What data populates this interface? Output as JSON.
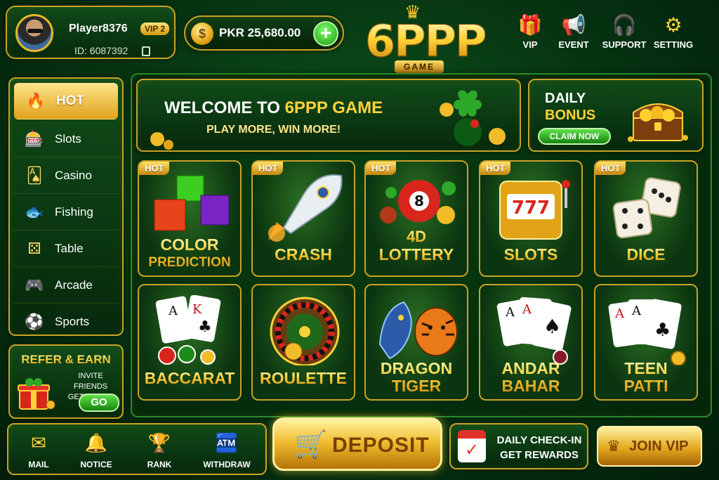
{
  "player": {
    "name": "Player8376",
    "vip": "VIP 2",
    "id": "ID: 6087392"
  },
  "balance": {
    "text": "PKR 25,680.00",
    "add": "+"
  },
  "logo": {
    "main": "6PPP",
    "sub": "GAME"
  },
  "top_actions": [
    {
      "label": "VIP",
      "icon": "gift-icon"
    },
    {
      "label": "EVENT",
      "icon": "megaphone-icon"
    },
    {
      "label": "SUPPORT",
      "icon": "headset-icon"
    },
    {
      "label": "SETTING",
      "icon": "gear-icon"
    }
  ],
  "sidebar": {
    "items": [
      {
        "label": "HOT",
        "icon": "flame-icon",
        "active": true
      },
      {
        "label": "Slots",
        "icon": "slot-machine-icon"
      },
      {
        "label": "Casino",
        "icon": "cards-icon"
      },
      {
        "label": "Fishing",
        "icon": "fish-icon"
      },
      {
        "label": "Table",
        "icon": "dice-icon"
      },
      {
        "label": "Arcade",
        "icon": "gamepad-icon"
      },
      {
        "label": "Sports",
        "icon": "soccer-ball-icon"
      }
    ]
  },
  "refer": {
    "title": "REFER & EARN",
    "line1": "INVITE FRIENDS",
    "line2": "GET BONUS",
    "button": "GO"
  },
  "welcome": {
    "title_prefix": "WELCOME TO ",
    "title_highlight": "6PPP GAME",
    "subtitle": "PLAY MORE, WIN MORE!"
  },
  "daily_bonus": {
    "line1": "DAILY",
    "line2": "BONUS",
    "button": "CLAIM NOW"
  },
  "games": [
    {
      "badge": "HOT",
      "line1": "COLOR",
      "line2": "PREDICTION"
    },
    {
      "badge": "HOT",
      "line1": "CRASH"
    },
    {
      "badge": "HOT",
      "line1": "LOTTERY",
      "art_label": "4D"
    },
    {
      "badge": "HOT",
      "line1": "SLOTS"
    },
    {
      "badge": "HOT",
      "line1": "DICE"
    },
    {
      "line1": "BACCARAT"
    },
    {
      "line1": "ROULETTE"
    },
    {
      "line1": "DRAGON",
      "line2": "TIGER"
    },
    {
      "line1": "ANDAR",
      "line2": "BAHAR"
    },
    {
      "line1": "TEEN",
      "line2": "PATTI"
    }
  ],
  "bottom_nav": [
    {
      "label": "MAIL",
      "icon": "envelope-icon"
    },
    {
      "label": "NOTICE",
      "icon": "bell-icon"
    },
    {
      "label": "RANK",
      "icon": "trophy-icon"
    },
    {
      "label": "WITHDRAW",
      "icon": "atm-icon"
    }
  ],
  "deposit": {
    "label": "DEPOSIT"
  },
  "checkin": {
    "line1": "DAILY CHECK-IN",
    "line2": "GET REWARDS"
  },
  "joinvip": {
    "label": "JOIN VIP"
  },
  "colors": {
    "gold": "#ffd23a",
    "green_bg": "#063412",
    "accent_green": "#1d9a14"
  }
}
